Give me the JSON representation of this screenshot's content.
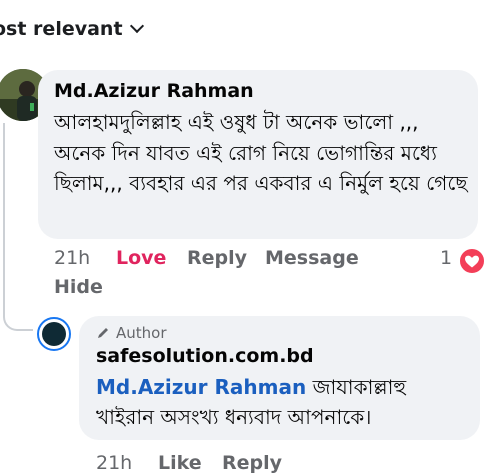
{
  "sort": {
    "label": "ost relevant"
  },
  "comment": {
    "author": "Md.Azizur Rahman",
    "text": "আলহামদুলিল্লাহ এই ওষুধ টা অনেক ভালো ,,, অনেক দিন যাবত এই রোগ নিয়ে ভোগান্তির মধ্যে ছিলাম,,, ব্যবহার এর পর একবার এ নির্মুল হয়ে গেছে",
    "time": "21h",
    "reaction_label": "Love",
    "reply_label": "Reply",
    "message_label": "Message",
    "hide_label": "Hide",
    "reaction_count": "1",
    "reaction_icon": "heart-icon",
    "reaction_color": "#f33e58"
  },
  "reply": {
    "badge": "Author",
    "author": "safesolution.com.bd",
    "mention": "Md.Azizur Rahman",
    "text": "জাযাকাল্লাহু খাইরান অসংখ্য ধন্যবাদ আপনাকে।",
    "time": "21h",
    "like_label": "Like",
    "reply_label": "Reply"
  },
  "colors": {
    "accent": "#1877f2",
    "mention": "#1b5fbf",
    "love": "#e0245e",
    "bubble": "#f0f2f5"
  }
}
